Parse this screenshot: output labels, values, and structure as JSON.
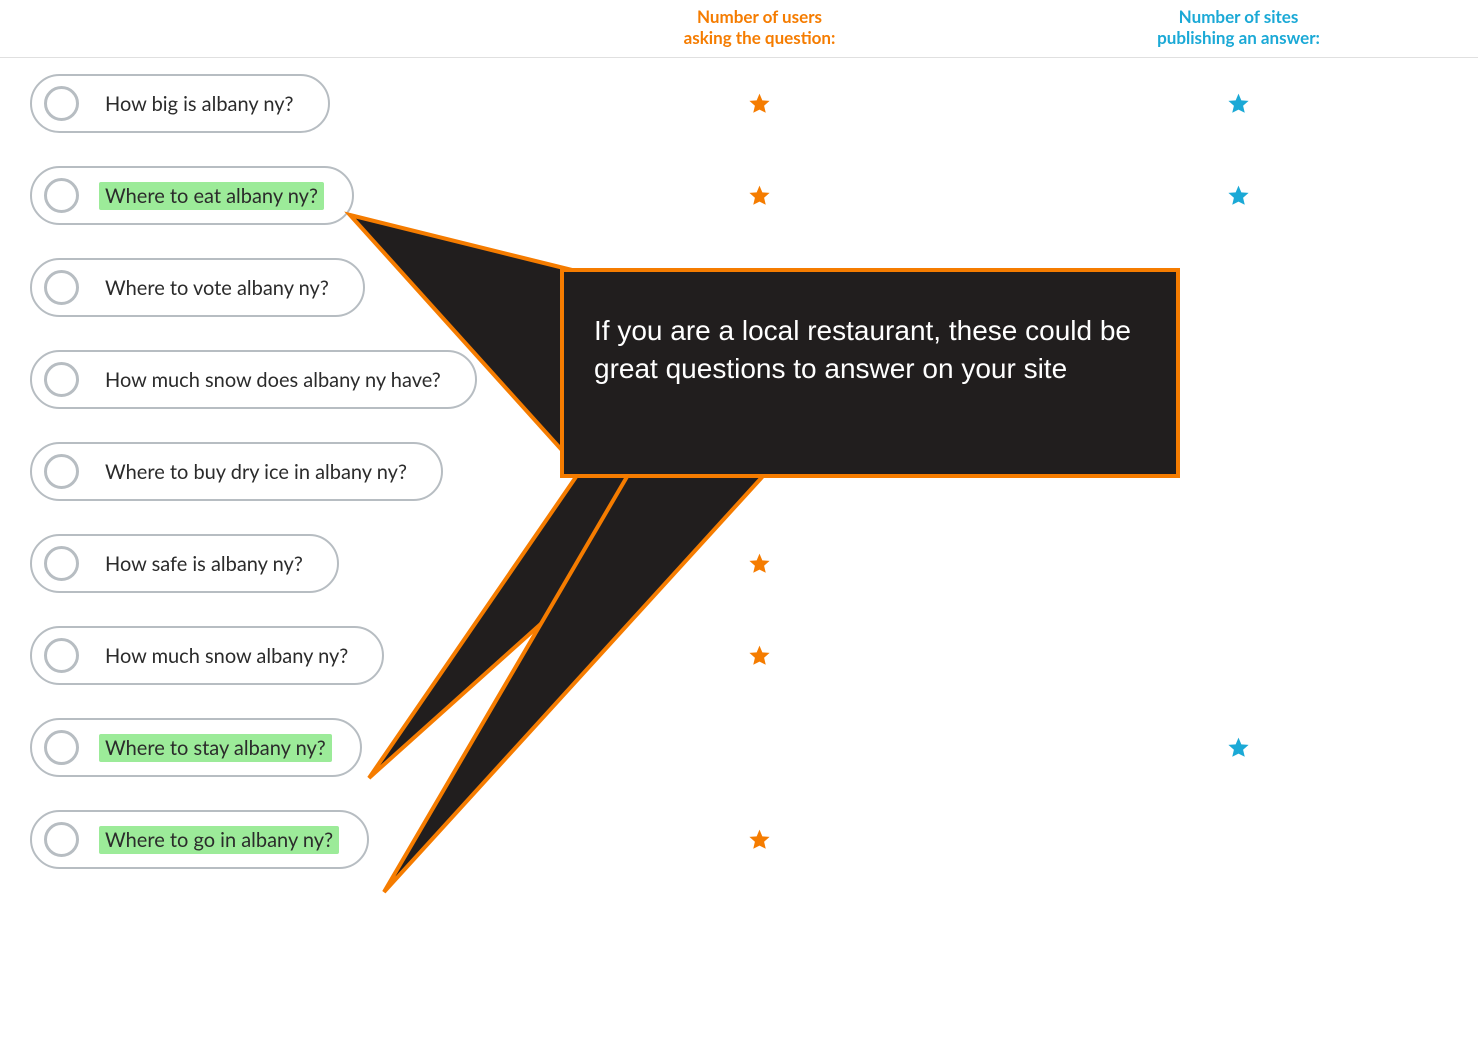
{
  "headers": {
    "users_line1": "Number of users",
    "users_line2": "asking the question:",
    "sites_line1": "Number of sites",
    "sites_line2": "publishing an answer:"
  },
  "rows": [
    {
      "label": "How big is albany ny?",
      "highlight": false,
      "user_star": true,
      "site_star": true
    },
    {
      "label": "Where to eat albany ny?",
      "highlight": true,
      "user_star": true,
      "site_star": true
    },
    {
      "label": "Where to vote albany ny?",
      "highlight": false,
      "user_star": false,
      "site_star": false
    },
    {
      "label": "How much snow does albany ny have?",
      "highlight": false,
      "user_star": false,
      "site_star": false
    },
    {
      "label": "Where to buy dry ice in albany ny?",
      "highlight": false,
      "user_star": false,
      "site_star": false
    },
    {
      "label": "How safe is albany ny?",
      "highlight": false,
      "user_star": true,
      "site_star": false
    },
    {
      "label": "How much snow albany ny?",
      "highlight": false,
      "user_star": true,
      "site_star": false
    },
    {
      "label": "Where to stay albany ny?",
      "highlight": true,
      "user_star": false,
      "site_star": true
    },
    {
      "label": "Where to go in albany ny?",
      "highlight": true,
      "user_star": true,
      "site_star": false
    }
  ],
  "callout": {
    "text": "If you are a local restaurant, these could be great questions to answer on your site"
  },
  "colors": {
    "orange": "#f57c00",
    "blue": "#1ba9d6",
    "highlight": "#9ceb99",
    "callout_bg": "#211e1e"
  }
}
